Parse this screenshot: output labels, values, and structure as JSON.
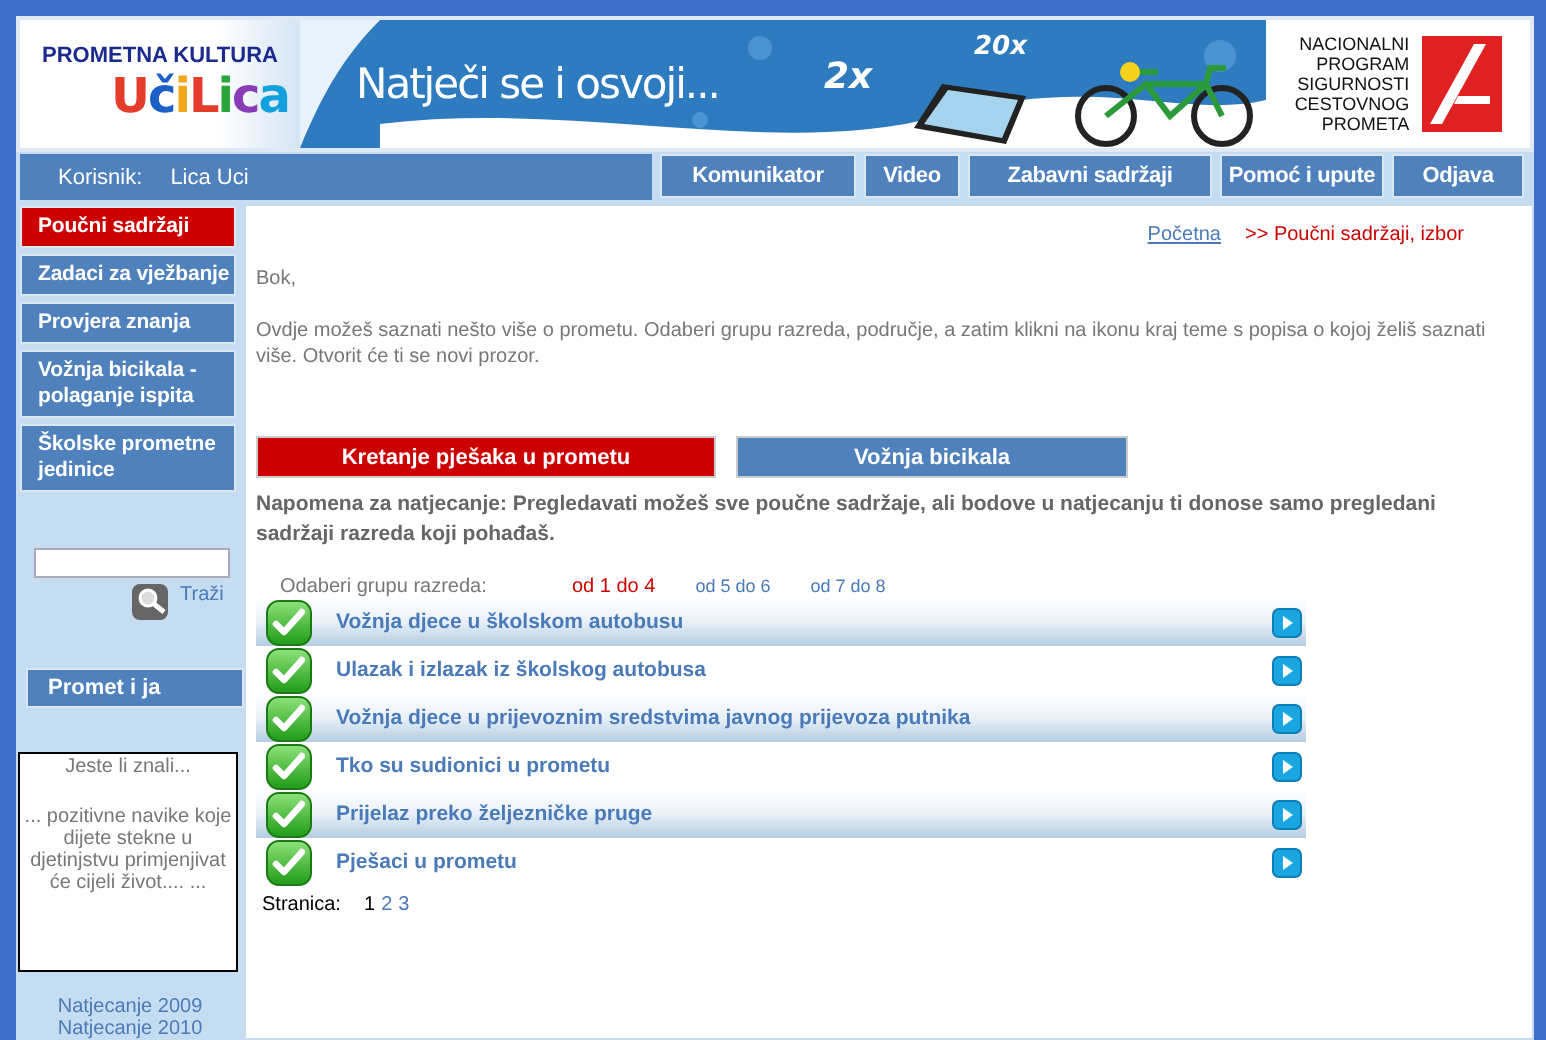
{
  "header": {
    "logo_title": "PROMETNA KULTURA",
    "logo_name": "UčiLica",
    "banner_text": "Natječi se i osvoji...",
    "banner_count_1": "2x",
    "banner_count_2": "20x",
    "program_name": [
      "NACIONALNI",
      "PROGRAM",
      "SIGURNOSTI",
      "CESTOVNOG",
      "PROMETA"
    ]
  },
  "user_bar": {
    "label": "Korisnik:",
    "name": "Lica Uci"
  },
  "nav_buttons": [
    "Komunikator",
    "Video",
    "Zabavni sadržaji",
    "Pomoć i upute",
    "Odjava"
  ],
  "sidebar": {
    "items": [
      {
        "label": "Poučni sadržaji",
        "selected": true
      },
      {
        "label": "Zadaci za vježbanje",
        "selected": false
      },
      {
        "label": "Provjera znanja",
        "selected": false
      },
      {
        "label": "Vožnja bicikala - polaganje ispita",
        "selected": false
      },
      {
        "label": "Školske prometne jedinice",
        "selected": false
      }
    ],
    "search": {
      "button": "Traži"
    },
    "promo_button": "Promet i ja",
    "fact_box": {
      "title": "Jeste li znali...",
      "text": "... pozitivne navike koje dijete stekne u djetinjstvu primjenjivat će cijeli život.... ..."
    },
    "links": [
      "Natjecanje 2009",
      "Natjecanje 2010"
    ]
  },
  "content": {
    "breadcrumb": {
      "link": "Početna",
      "current": ">> Poučni sadržaji, izbor"
    },
    "greeting": "Bok,",
    "intro": "Ovdje možeš saznati nešto više o prometu. Odaberi grupu razreda, područje, a zatim klikni na ikonu kraj teme s popisa o kojoj želiš saznati više. Otvorit će ti se novi prozor.",
    "tabs": [
      {
        "label": "Kretanje pješaka u prometu",
        "selected": true
      },
      {
        "label": "Vožnja bicikala",
        "selected": false
      }
    ],
    "note": "Napomena za natjecanje: Pregledavati možeš sve poučne sadržaje, ali bodove u natjecanju ti donose samo pregledani sadržaji razreda koji pohađaš.",
    "grade_filter": {
      "label": "Odaberi grupu razreda:",
      "options": [
        {
          "label": "od 1 do 4",
          "selected": true
        },
        {
          "label": "od 5 do 6",
          "selected": false
        },
        {
          "label": "od 7 do 8",
          "selected": false
        }
      ]
    },
    "topics": [
      {
        "title": "Vožnja djece u školskom autobusu",
        "done": true
      },
      {
        "title": "Ulazak i izlazak iz školskog autobusa",
        "done": true
      },
      {
        "title": "Vožnja djece u prijevoznim sredstvima javnog prijevoza putnika",
        "done": true
      },
      {
        "title": "Tko su sudionici u prometu",
        "done": true
      },
      {
        "title": "Prijelaz preko željezničke pruge",
        "done": true
      },
      {
        "title": "Pješaci u prometu",
        "done": true
      }
    ],
    "pagination": {
      "label": "Stranica:",
      "pages": [
        {
          "label": "1",
          "selected": true
        },
        {
          "label": "2",
          "selected": false
        },
        {
          "label": "3",
          "selected": false
        }
      ]
    }
  }
}
